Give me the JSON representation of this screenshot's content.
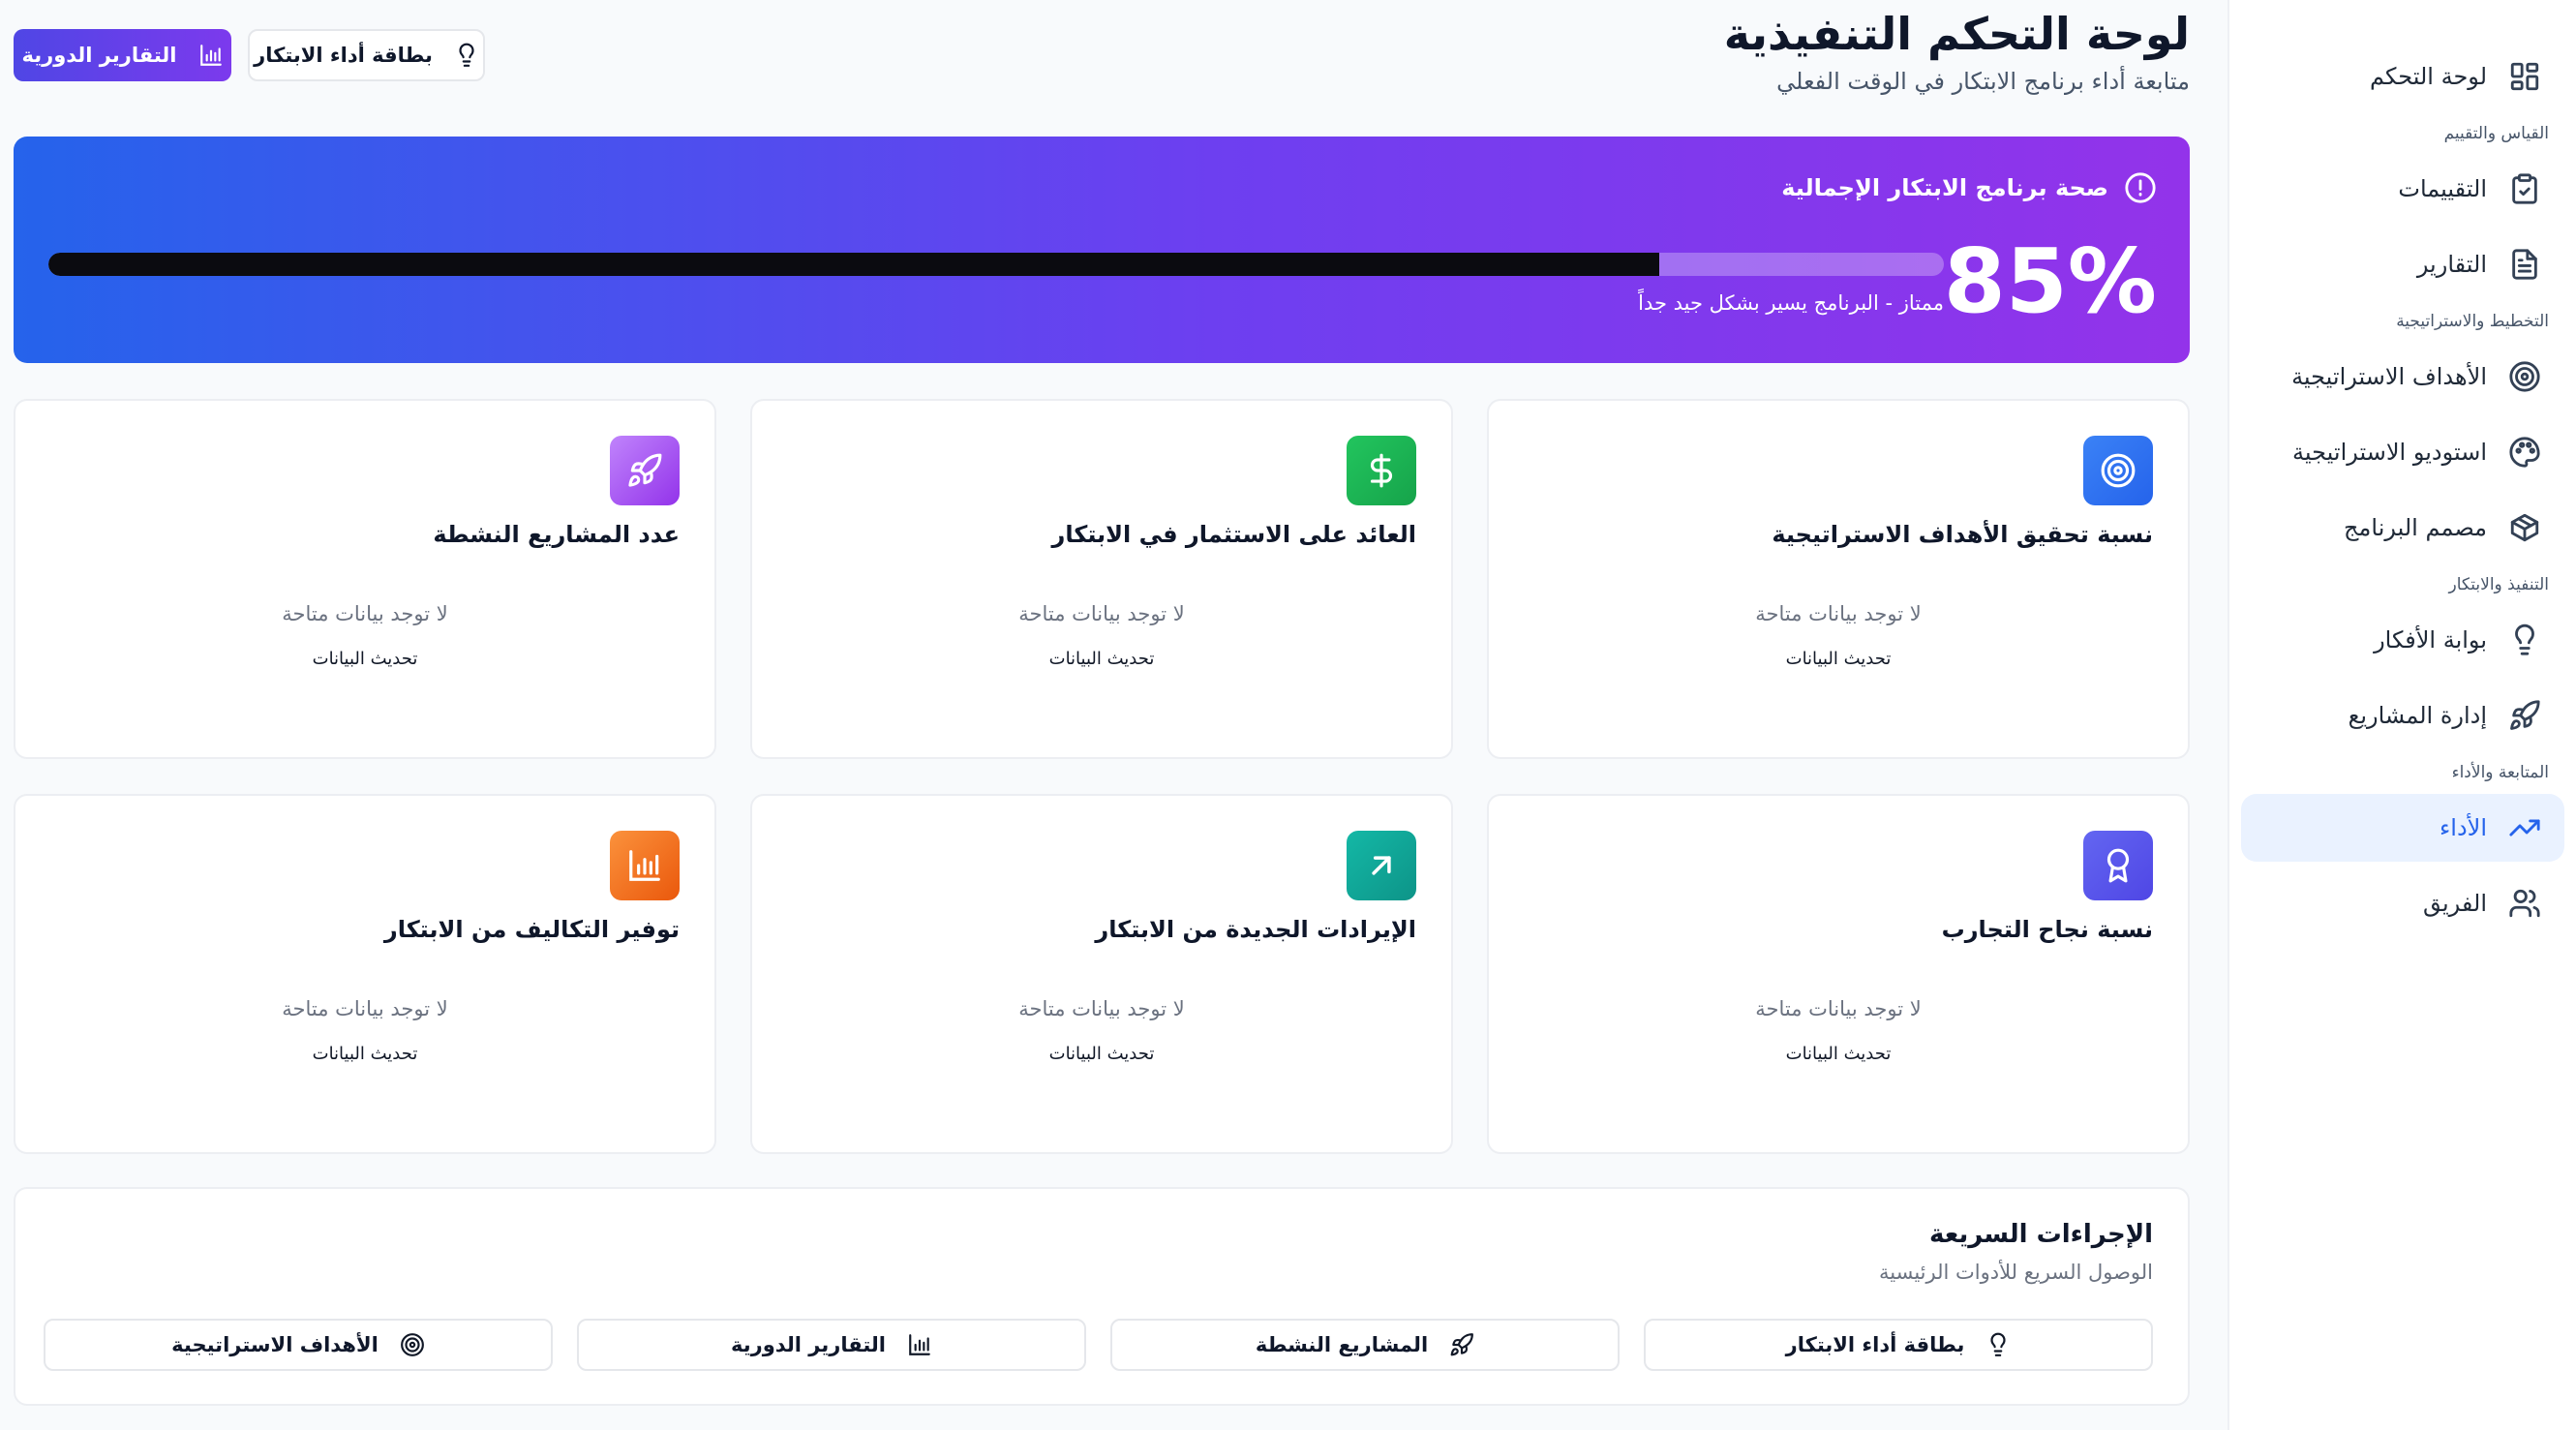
{
  "header": {
    "title": "لوحة التحكم التنفيذية",
    "subtitle": "متابعة أداء برنامج الابتكار في الوقت الفعلي",
    "btn_periodic_reports": "التقارير الدورية",
    "btn_innovation_card": "بطاقة أداء الابتكار"
  },
  "sidebar": {
    "dashboard": "لوحة التحكم",
    "sections": {
      "measurement": "القياس والتقييم",
      "planning": "التخطيط والاستراتيجية",
      "execution": "التنفيذ والابتكار",
      "monitoring": "المتابعة والأداء"
    },
    "items": {
      "evaluations": "التقييمات",
      "reports": "التقارير",
      "strategic_goals": "الأهداف الاستراتيجية",
      "strategy_studio": "استوديو الاستراتيجية",
      "program_designer": "مصمم البرنامج",
      "ideas_portal": "بوابة الأفكار",
      "project_management": "إدارة المشاريع",
      "performance": "الأداء",
      "team": "الفريق"
    },
    "active_item": "الأداء"
  },
  "health": {
    "title": "صحة برنامج الابتكار الإجمالية",
    "score": "85%",
    "progress_fraction": 0.85,
    "status": "ممتاز - البرنامج يسير بشكل جيد جداً"
  },
  "cards": [
    {
      "title": "نسبة تحقيق الأهداف الاستراتيجية",
      "empty": "لا توجد بيانات متاحة",
      "refresh": "تحديث البيانات",
      "icon": "target-icon",
      "color": "#3b82f6"
    },
    {
      "title": "العائد على الاستثمار في الابتكار",
      "empty": "لا توجد بيانات متاحة",
      "refresh": "تحديث البيانات",
      "icon": "dollar-icon",
      "color": "#22c55e"
    },
    {
      "title": "عدد المشاريع النشطة",
      "empty": "لا توجد بيانات متاحة",
      "refresh": "تحديث البيانات",
      "icon": "rocket-icon",
      "color": "#a855f7"
    },
    {
      "title": "نسبة نجاح التجارب",
      "empty": "لا توجد بيانات متاحة",
      "refresh": "تحديث البيانات",
      "icon": "award-icon",
      "color": "#6366f1"
    },
    {
      "title": "الإيرادات الجديدة من الابتكار",
      "empty": "لا توجد بيانات متاحة",
      "refresh": "تحديث البيانات",
      "icon": "arrow-up-right-icon",
      "color": "#14b8a6"
    },
    {
      "title": "توفير التكاليف من الابتكار",
      "empty": "لا توجد بيانات متاحة",
      "refresh": "تحديث البيانات",
      "icon": "bar-chart-icon",
      "color": "#f97316"
    }
  ],
  "quick_actions": {
    "title": "الإجراءات السريعة",
    "subtitle": "الوصول السريع للأدوات الرئيسية",
    "buttons": [
      {
        "label": "بطاقة أداء الابتكار",
        "icon": "lightbulb-icon"
      },
      {
        "label": "المشاريع النشطة",
        "icon": "rocket-icon"
      },
      {
        "label": "التقارير الدورية",
        "icon": "bar-chart-icon"
      },
      {
        "label": "الأهداف الاستراتيجية",
        "icon": "target-icon"
      }
    ]
  }
}
